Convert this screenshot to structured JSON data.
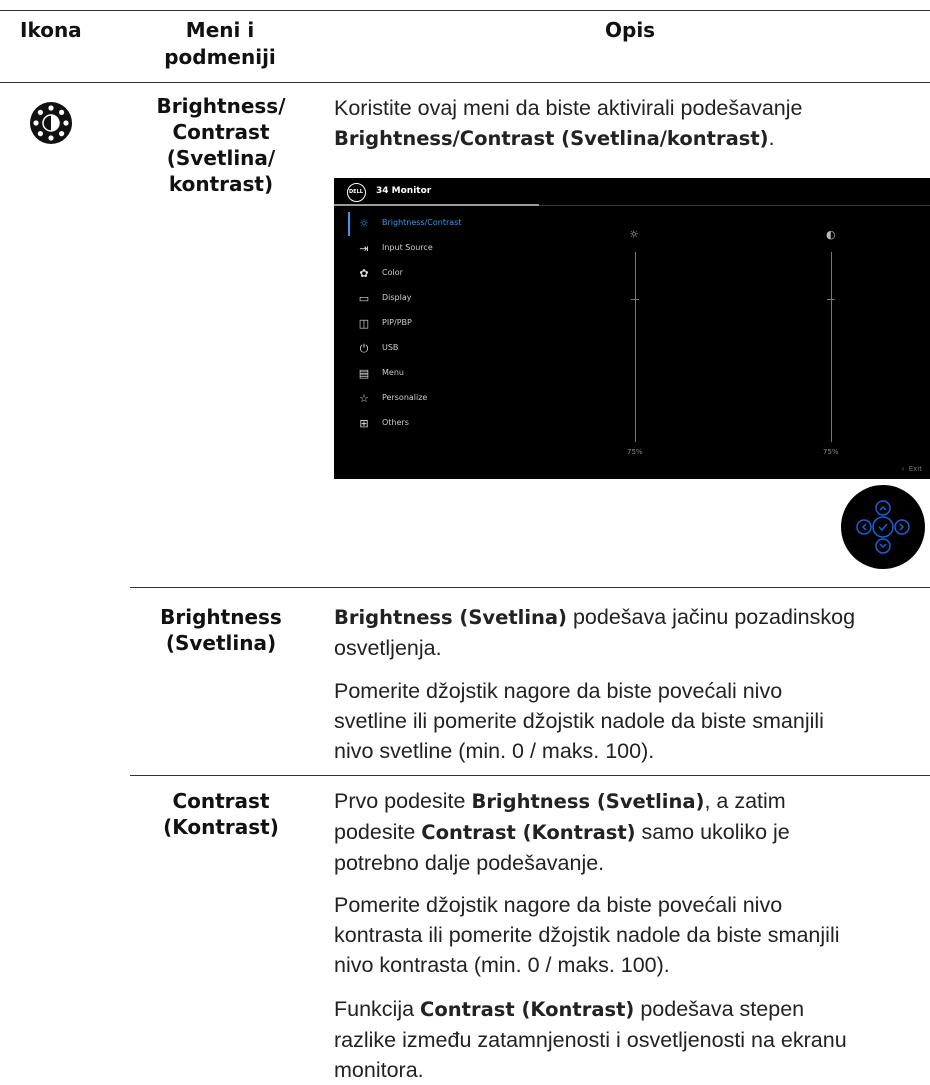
{
  "header": {
    "col_icon": "Ikona",
    "col_menu_line1": "Meni i",
    "col_menu_line2": "podmeniji",
    "col_desc": "Opis"
  },
  "row_main": {
    "icon": "brightness-contrast-icon",
    "menu_lines": [
      "Brightness/",
      "Contrast",
      "(Svetlina/",
      "kontrast)"
    ],
    "intro_line1": "Koristite ovaj meni da biste aktivirali podešavanje",
    "intro_bold": "Brightness/Contrast (Svetlina/kontrast)",
    "intro_end": "."
  },
  "osd": {
    "title": "34 Monitor",
    "logo_text": "DELL",
    "items": [
      {
        "label": "Brightness/Contrast",
        "icon": "sun-icon",
        "active": true
      },
      {
        "label": "Input Source",
        "icon": "input-source-icon",
        "active": false
      },
      {
        "label": "Color",
        "icon": "color-icon",
        "active": false
      },
      {
        "label": "Display",
        "icon": "display-icon",
        "active": false
      },
      {
        "label": "PIP/PBP",
        "icon": "pip-pbp-icon",
        "active": false
      },
      {
        "label": "USB",
        "icon": "usb-icon",
        "active": false
      },
      {
        "label": "Menu",
        "icon": "menu-icon",
        "active": false
      },
      {
        "label": "Personalize",
        "icon": "star-icon",
        "active": false
      },
      {
        "label": "Others",
        "icon": "others-icon",
        "active": false
      }
    ],
    "brightness_value": "75%",
    "contrast_value": "75%",
    "brightness_level": 75,
    "contrast_level": 75,
    "exit_label": "Exit",
    "accent_color": "#2a9df4"
  },
  "joystick": {
    "icon": "joystick-icon",
    "color": "#0a4db3"
  },
  "row_brightness": {
    "menu_lines": [
      "Brightness",
      "(Svetlina)"
    ],
    "p1_bold": "Brightness (Svetlina)",
    "p1_line1_rest": " podešava jačinu pozadinskog",
    "p1_line2": "osvetljenja.",
    "p2_lines": [
      "Pomerite džojstik nagore da biste povećali nivo",
      "svetline ili pomerite džojstik nadole da biste smanjili",
      "nivo svetline (min. 0 / maks. 100)."
    ]
  },
  "row_contrast": {
    "menu_lines": [
      "Contrast",
      "(Kontrast)"
    ],
    "p1_line1_pre": "Prvo podesite ",
    "p1_line1_bold": "Brightness (Svetlina)",
    "p1_line1_post": ", a zatim",
    "p1_line2_pre": "podesite ",
    "p1_line2_bold": "Contrast (Kontrast)",
    "p1_line2_post": " samo ukoliko je",
    "p1_line3": "potrebno dalje podešavanje.",
    "p2_lines": [
      "Pomerite džojstik nagore da biste povećali nivo",
      "kontrasta ili pomerite džojstik nadole da biste smanjili",
      "nivo kontrasta (min. 0 / maks. 100)."
    ],
    "p3_line1_pre": "Funkcija ",
    "p3_line1_bold": "Contrast (Kontrast)",
    "p3_line1_post": " podešava stepen",
    "p3_line2": "razlike između zatamnjenosti i osvetljenosti na ekranu",
    "p3_line3": "monitora."
  }
}
